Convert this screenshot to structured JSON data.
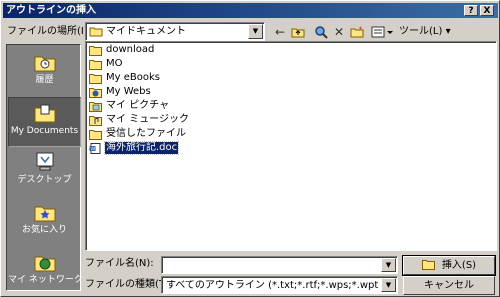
{
  "window": {
    "title": "アウトラインの挿入"
  },
  "titlebar_buttons": {
    "help": "?",
    "close": "X"
  },
  "toolbar": {
    "look_in_label": "ファイルの場所(I):",
    "look_in_value": "マイドキュメント",
    "tools_label": "ツール(L)"
  },
  "places": [
    {
      "label": "履歴",
      "icon": "history-folder-icon"
    },
    {
      "label": "My Documents",
      "icon": "my-documents-folder-icon"
    },
    {
      "label": "デスクトップ",
      "icon": "desktop-icon"
    },
    {
      "label": "お気に入り",
      "icon": "favorites-folder-icon"
    },
    {
      "label": "マイ ネットワーク",
      "icon": "network-globe-icon"
    }
  ],
  "files": [
    {
      "name": "download",
      "icon": "folder-icon"
    },
    {
      "name": "MO",
      "icon": "folder-icon"
    },
    {
      "name": "My eBooks",
      "icon": "folder-icon"
    },
    {
      "name": "My Webs",
      "icon": "web-folder-icon"
    },
    {
      "name": "マイ ピクチャ",
      "icon": "pictures-folder-icon"
    },
    {
      "name": "マイ ミュージック",
      "icon": "music-folder-icon"
    },
    {
      "name": "受信したファイル",
      "icon": "folder-icon"
    },
    {
      "name": "海外旅行記.doc",
      "icon": "word-document-icon",
      "selected": true
    }
  ],
  "filename": {
    "label": "ファイル名(N):",
    "value": ""
  },
  "filetype": {
    "label": "ファイルの種類(T):",
    "value": "すべてのアウトライン (*.txt;*.rtf;*.wps;*.wpt;*.doc;*.owk;*.dot)"
  },
  "buttons": {
    "insert": "挿入(S)",
    "cancel": "キャンセル"
  },
  "colors": {
    "title_start": "#0a246a",
    "title_end": "#3a6ea5",
    "dialog": "#d4d0c8",
    "places_bg": "#808080",
    "selection": "#0a246a"
  }
}
